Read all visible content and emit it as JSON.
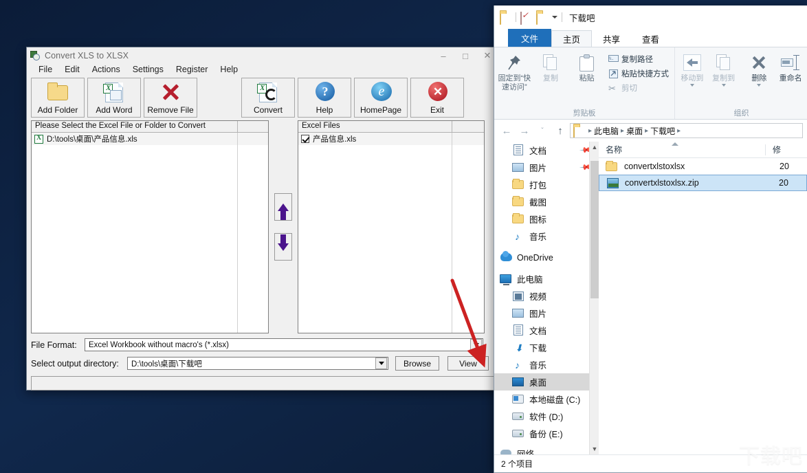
{
  "app": {
    "title": "Convert XLS to XLSX",
    "titlebar_buttons": [
      {
        "name": "minimize",
        "glyph": "–"
      },
      {
        "name": "maximize",
        "glyph": "□"
      },
      {
        "name": "close",
        "glyph": "✕"
      }
    ],
    "menu": [
      "File",
      "Edit",
      "Actions",
      "Settings",
      "Register",
      "Help"
    ],
    "toolbar": [
      {
        "label": "Add Folder",
        "icon": "folder-icon"
      },
      {
        "label": "Add Word",
        "icon": "excel-document-icon"
      },
      {
        "label": "Remove File",
        "icon": "red-x-icon"
      },
      {
        "label": "Convert",
        "icon": "convert-icon"
      },
      {
        "label": "Help",
        "icon": "question-mark-icon"
      },
      {
        "label": "HomePage",
        "icon": "internet-explorer-icon"
      },
      {
        "label": "Exit",
        "icon": "red-circle-x-icon"
      }
    ],
    "left_list": {
      "header": "Please Select the Excel File or Folder to Convert",
      "rows": [
        {
          "name": "D:\\tools\\桌面\\产品信息.xls"
        }
      ]
    },
    "right_list": {
      "header": "Excel Files",
      "rows": [
        {
          "name": "产品信息.xls",
          "checked": true
        }
      ]
    },
    "move_buttons": [
      {
        "name": "move-up",
        "icon": "arrow-up-icon"
      },
      {
        "name": "move-down",
        "icon": "arrow-down-icon"
      }
    ],
    "file_format_label": "File Format:",
    "file_format_value": "Excel Workbook without macro's (*.xlsx)",
    "output_dir_label": "Select  output directory:",
    "output_dir_value": "D:\\tools\\桌面\\下载吧",
    "browse_label": "Browse",
    "view_label": "View",
    "status_text": ""
  },
  "explorer": {
    "title": "下载吧",
    "quick_access": [
      {
        "name": "folder-icon"
      },
      {
        "name": "properties-icon"
      },
      {
        "name": "new-folder-icon"
      },
      {
        "name": "customize-caret-icon"
      }
    ],
    "tabs": [
      {
        "label": "文件",
        "state": "file"
      },
      {
        "label": "主页",
        "state": "active"
      },
      {
        "label": "共享",
        "state": "normal"
      },
      {
        "label": "查看",
        "state": "normal"
      }
    ],
    "ribbon": {
      "clipboard": {
        "group_name": "剪贴板",
        "pin_label": "固定到“快速访问”",
        "copy_label": "复制",
        "paste_label": "粘贴",
        "copy_path_label": "复制路径",
        "paste_shortcut_label": "粘贴快捷方式",
        "cut_label": "剪切"
      },
      "organize": {
        "group_name": "组织",
        "move_to_label": "移动到",
        "copy_to_label": "复制到",
        "delete_label": "删除",
        "rename_label": "重命名"
      }
    },
    "address": {
      "back": "←",
      "forward": "→",
      "recent": "ˇ",
      "up": "↑",
      "crumbs": [
        "此电脑",
        "桌面",
        "下载吧"
      ]
    },
    "nav_items": [
      {
        "label": "文档",
        "icon": "document-icon",
        "level": 1,
        "pinned": true
      },
      {
        "label": "图片",
        "icon": "picture-icon",
        "level": 1,
        "pinned": true
      },
      {
        "label": "打包",
        "icon": "folder-icon",
        "level": 1
      },
      {
        "label": "截图",
        "icon": "folder-icon",
        "level": 1
      },
      {
        "label": "图标",
        "icon": "folder-icon",
        "level": 1
      },
      {
        "label": "音乐",
        "icon": "music-icon",
        "level": 1
      },
      {
        "label": "OneDrive",
        "icon": "onedrive-icon",
        "level": 0
      },
      {
        "label": "此电脑",
        "icon": "this-pc-icon",
        "level": 0
      },
      {
        "label": "视频",
        "icon": "video-icon",
        "level": 1
      },
      {
        "label": "图片",
        "icon": "picture-icon",
        "level": 1
      },
      {
        "label": "文档",
        "icon": "document-icon",
        "level": 1
      },
      {
        "label": "下载",
        "icon": "download-icon",
        "level": 1
      },
      {
        "label": "音乐",
        "icon": "music-icon",
        "level": 1
      },
      {
        "label": "桌面",
        "icon": "desktop-icon",
        "level": 1,
        "selected": true
      },
      {
        "label": "本地磁盘 (C:)",
        "icon": "system-drive-icon",
        "level": 1
      },
      {
        "label": "软件 (D:)",
        "icon": "drive-icon",
        "level": 1
      },
      {
        "label": "备份 (E:)",
        "icon": "drive-icon",
        "level": 1
      },
      {
        "label": "网络",
        "icon": "network-icon",
        "level": 0
      }
    ],
    "columns": [
      {
        "label": "名称"
      },
      {
        "label": "修"
      }
    ],
    "files": [
      {
        "name": "convertxlstoxlsx",
        "icon": "folder-icon",
        "date": "20",
        "selected": false
      },
      {
        "name": "convertxlstoxlsx.zip",
        "icon": "zip-icon",
        "date": "20",
        "selected": true
      }
    ],
    "status": "2 个项目"
  },
  "watermark": "下载吧",
  "colors": {
    "desktop": "#0d2040",
    "ribbon_file_tab": "#1f6fba",
    "selection": "#cce4f7",
    "arrow_annotation": "#cc2222"
  }
}
